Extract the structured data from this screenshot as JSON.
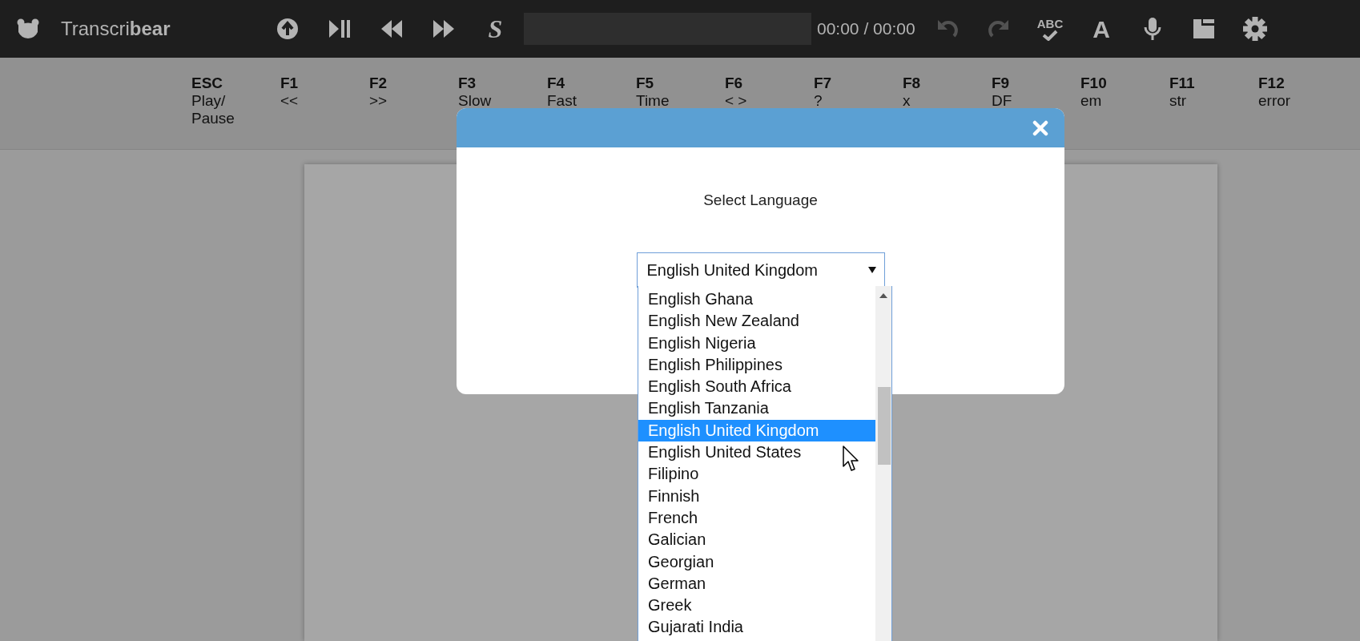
{
  "app": {
    "title": "Transcri**bear**"
  },
  "toolbar": {
    "slow_glyph": "S",
    "time": "00:00 / 00:00",
    "undo": {
      "disabled": true
    },
    "redo": {
      "disabled": true
    },
    "spellcheck_label": "ABC",
    "font_glyph": "A"
  },
  "hotkeys": [
    {
      "key": "ESC",
      "label": "Play/ Pause"
    },
    {
      "key": "F1",
      "label": "<<"
    },
    {
      "key": "F2",
      "label": ">>"
    },
    {
      "key": "F3",
      "label": "Slow"
    },
    {
      "key": "F4",
      "label": "Fast"
    },
    {
      "key": "F5",
      "label": "Time"
    },
    {
      "key": "F6",
      "label": "< >"
    },
    {
      "key": "F7",
      "label": "?"
    },
    {
      "key": "F8",
      "label": "x"
    },
    {
      "key": "F9",
      "label": "DF"
    },
    {
      "key": "F10",
      "label": "em"
    },
    {
      "key": "F11",
      "label": "str"
    },
    {
      "key": "F12",
      "label": "error"
    }
  ],
  "modal": {
    "prompt": "Select Language",
    "select": {
      "value": "English United Kingdom",
      "expanded": true,
      "options": [
        {
          "label": "English Ghana",
          "selected": false
        },
        {
          "label": "English New Zealand",
          "selected": false
        },
        {
          "label": "English Nigeria",
          "selected": false
        },
        {
          "label": "English Philippines",
          "selected": false
        },
        {
          "label": "English South Africa",
          "selected": false
        },
        {
          "label": "English Tanzania",
          "selected": false
        },
        {
          "label": "English United Kingdom",
          "selected": true
        },
        {
          "label": "English United States",
          "selected": false
        },
        {
          "label": "Filipino",
          "selected": false
        },
        {
          "label": "Finnish",
          "selected": false
        },
        {
          "label": "French",
          "selected": false
        },
        {
          "label": "Galician",
          "selected": false
        },
        {
          "label": "Georgian",
          "selected": false
        },
        {
          "label": "German",
          "selected": false
        },
        {
          "label": "Greek",
          "selected": false
        },
        {
          "label": "Gujarati India",
          "selected": false
        }
      ]
    }
  }
}
